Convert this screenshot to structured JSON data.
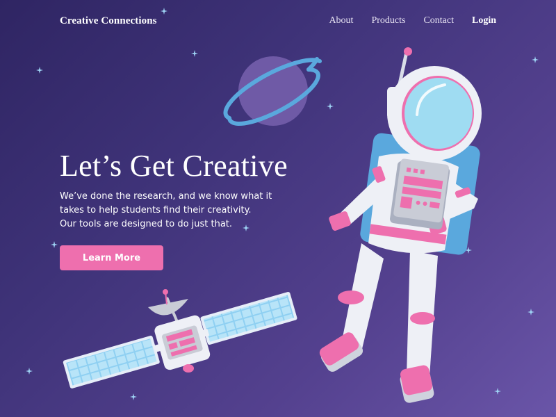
{
  "header": {
    "brand": "Creative Connections",
    "nav": [
      {
        "label": "About"
      },
      {
        "label": "Products"
      },
      {
        "label": "Contact"
      },
      {
        "label": "Login"
      }
    ]
  },
  "hero": {
    "title": "Let’s Get Creative",
    "lines": [
      "We’ve done the research, and we know what it",
      "takes to help students find their creativity.",
      "Our tools are designed to do just that."
    ],
    "cta_label": "Learn More"
  },
  "colors": {
    "background_start": "#2f2563",
    "background_end": "#6a55a8",
    "accent_pink": "#ee6fae",
    "planet": "#6f5aa6",
    "planet_ring": "#5aa8dd",
    "visor": "#9fdcf2",
    "suit": "#eef0f6",
    "star": "#9fd4f5"
  },
  "illustrations": [
    "planet",
    "astronaut",
    "satellite",
    "stars"
  ]
}
